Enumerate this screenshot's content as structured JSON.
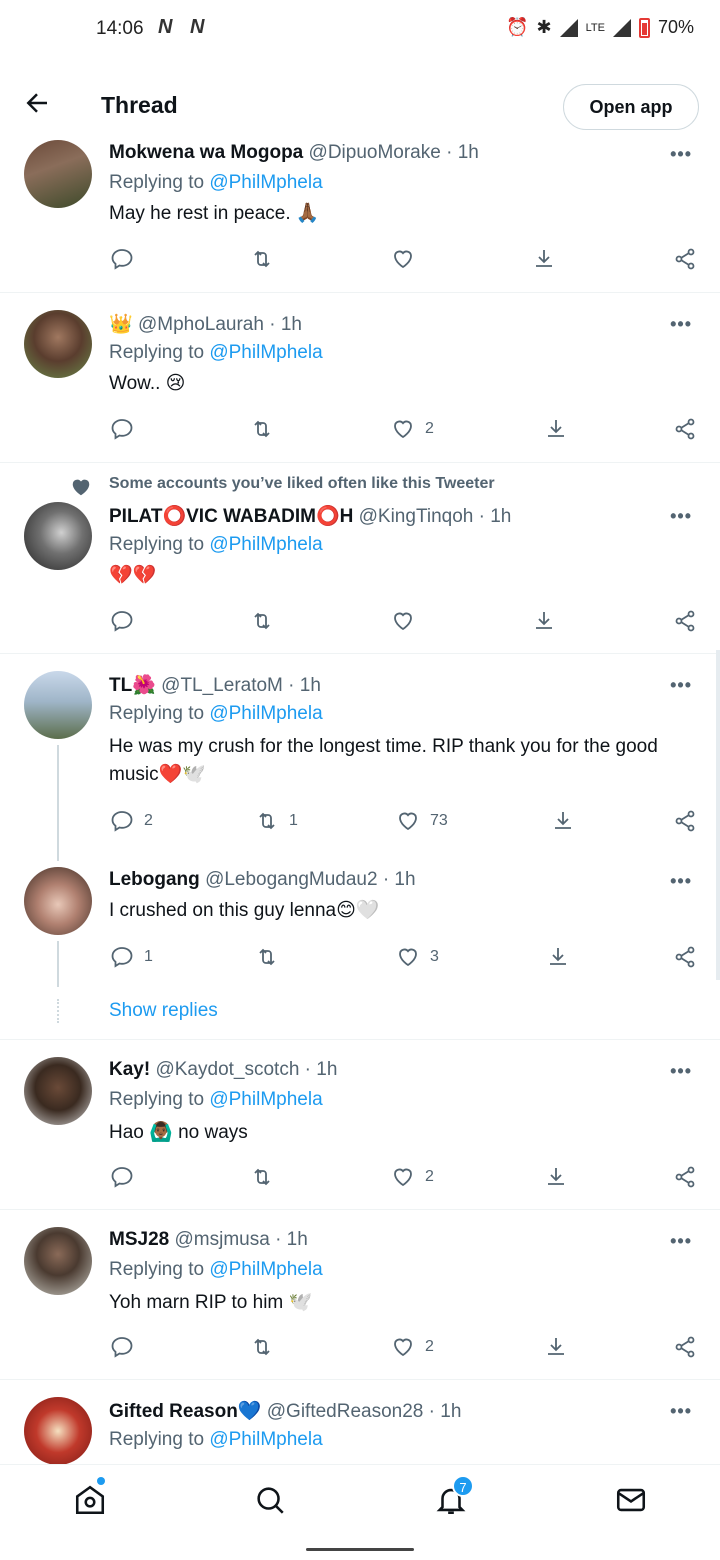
{
  "status_bar": {
    "time": "14:06",
    "left_icons": "N N",
    "network": "LTE",
    "battery": "70%"
  },
  "header": {
    "title": "Thread",
    "open_app": "Open app"
  },
  "tweets": [
    {
      "name": "Mokwena wa Mogopa",
      "handle": "@DipuoMorake",
      "time": "· 1h",
      "replying_label": "Replying to",
      "replying_to": "@PhilMphela",
      "text": "May he rest in peace. 🙏🏾",
      "replies": "",
      "retweets": "",
      "likes": ""
    },
    {
      "name": "👑",
      "handle": "@MphoLaurah",
      "time": "· 1h",
      "replying_label": "Replying to",
      "replying_to": "@PhilMphela",
      "text": "Wow.. 😢",
      "replies": "",
      "retweets": "",
      "likes": "2"
    },
    {
      "social": "Some accounts you’ve liked often like this Tweeter",
      "name": "PILAT⭕VIC WABADIM⭕H",
      "handle": "@KingTinqoh",
      "time": "· 1h",
      "replying_label": "Replying to",
      "replying_to": "@PhilMphela",
      "text": "💔💔",
      "replies": "",
      "retweets": "",
      "likes": ""
    },
    {
      "name": "TL🌺",
      "handle": "@TL_LeratoM",
      "time": "· 1h",
      "replying_label": "Replying to",
      "replying_to": "@PhilMphela",
      "text": "He was my crush for the longest time. RIP thank you for the good music❤️🕊️",
      "replies": "2",
      "retweets": "1",
      "likes": "73"
    },
    {
      "name": "Lebogang",
      "handle": "@LebogangMudau2",
      "time": "· 1h",
      "text": "I crushed on this guy lenna😊🤍",
      "replies": "1",
      "retweets": "",
      "likes": "3"
    },
    {
      "name": "Kay!",
      "handle": "@Kaydot_scotch",
      "time": "· 1h",
      "replying_label": "Replying to",
      "replying_to": "@PhilMphela",
      "text": "Hao 🙆🏾‍♂️ no ways",
      "replies": "",
      "retweets": "",
      "likes": "2"
    },
    {
      "name": "MSJ28",
      "handle": "@msjmusa",
      "time": "· 1h",
      "replying_label": "Replying to",
      "replying_to": "@PhilMphela",
      "text": "Yoh marn RIP to him 🕊️",
      "replies": "",
      "retweets": "",
      "likes": "2"
    },
    {
      "name": "Gifted Reason💙",
      "handle": "@GiftedReason28",
      "time": "· 1h",
      "replying_label": "Replying to",
      "replying_to": "@PhilMphela"
    }
  ],
  "show_replies": "Show replies",
  "more": "•••",
  "nav": {
    "notifications_badge": "7"
  },
  "colors": {
    "accent": "#1d9bf0",
    "muted": "#536471",
    "text": "#0f1419"
  }
}
